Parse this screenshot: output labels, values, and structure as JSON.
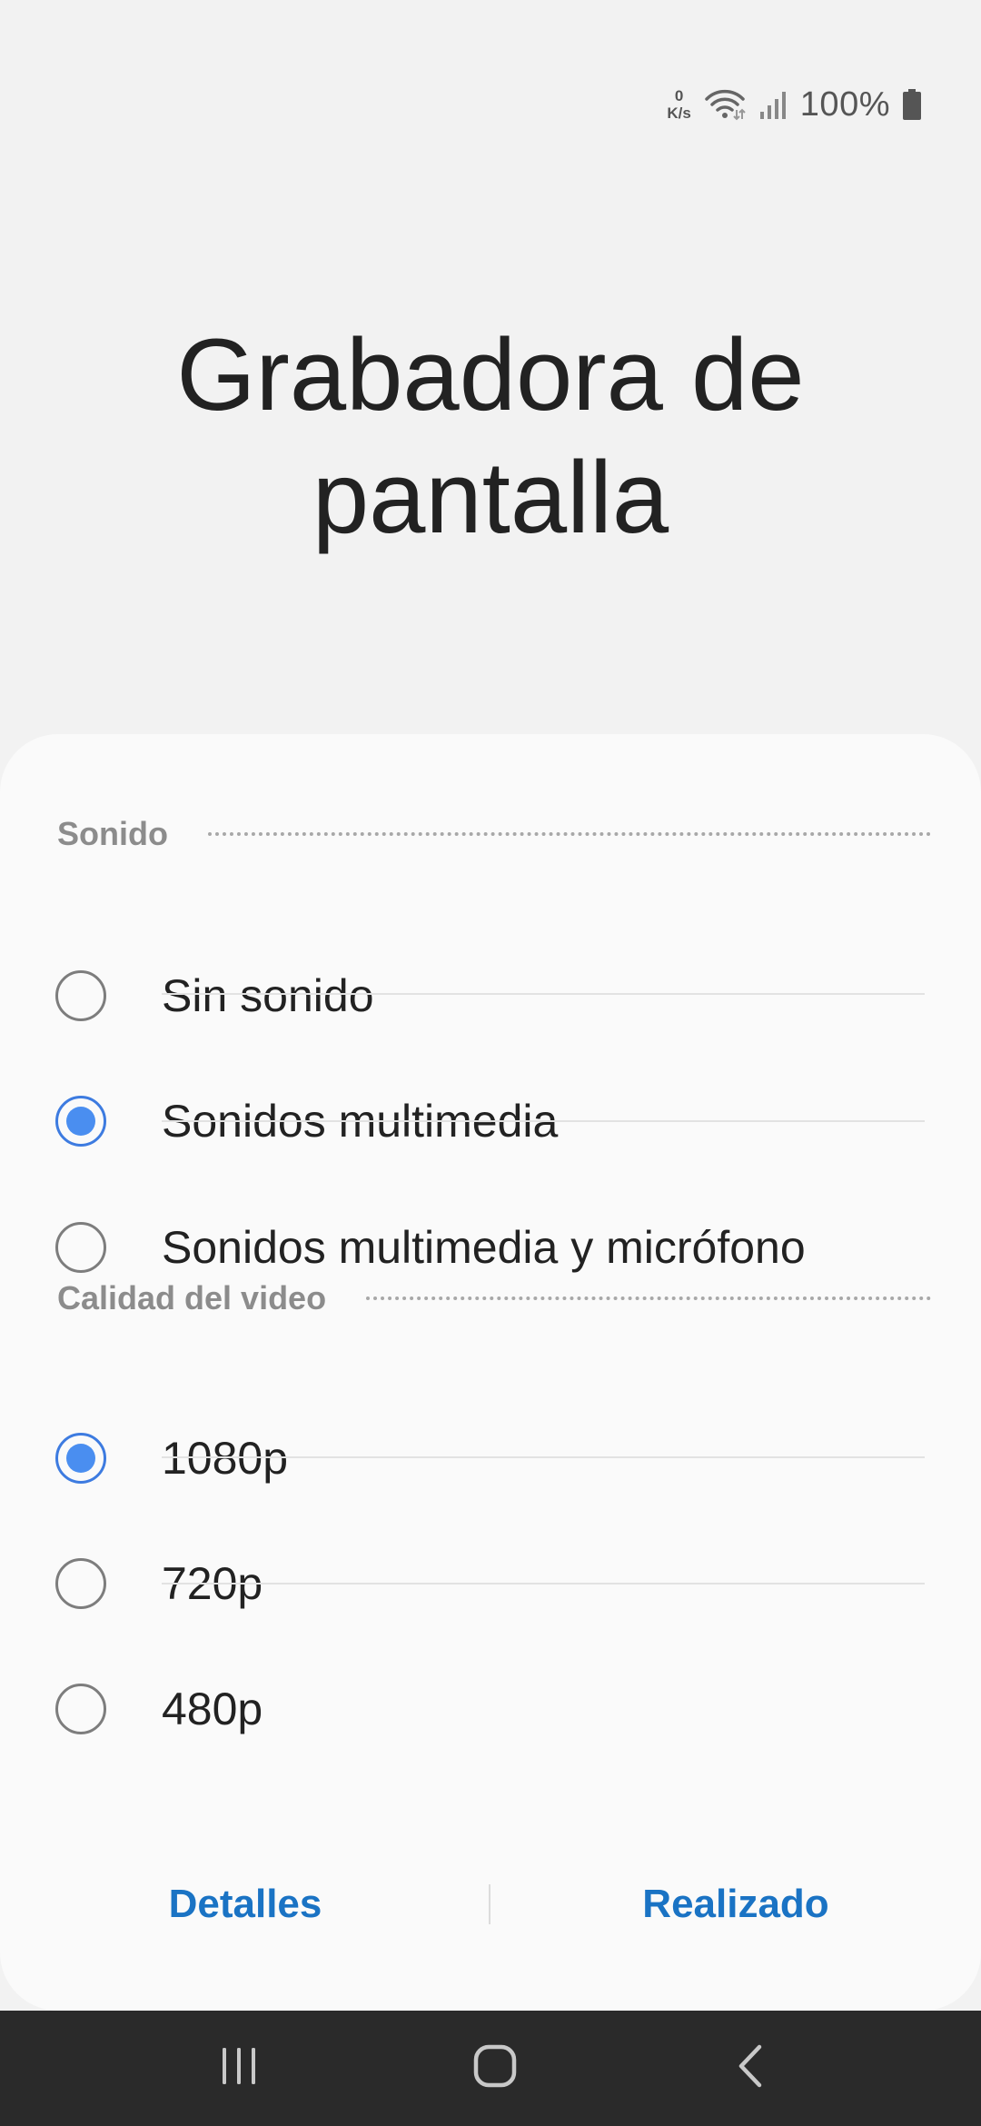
{
  "status_bar": {
    "net_speed_value": "0",
    "net_speed_unit": "K/s",
    "battery_percent": "100%"
  },
  "title": "Grabadora de pantalla",
  "sound_section": {
    "header": "Sonido",
    "options": [
      {
        "label": "Sin sonido",
        "selected": false
      },
      {
        "label": "Sonidos multimedia",
        "selected": true
      },
      {
        "label": "Sonidos multimedia y micrófono",
        "selected": false
      }
    ]
  },
  "video_section": {
    "header": "Calidad del video",
    "options": [
      {
        "label": "1080p",
        "selected": true
      },
      {
        "label": "720p",
        "selected": false
      },
      {
        "label": "480p",
        "selected": false
      }
    ]
  },
  "buttons": {
    "details": "Detalles",
    "done": "Realizado"
  },
  "colors": {
    "accent": "#1a73c4",
    "radio_selected": "#4a8ef0",
    "background": "#f2f2f2",
    "sheet": "#fafafa",
    "nav_bar": "#2a2a2a"
  },
  "nav_bar": {
    "icons": [
      "recents-icon",
      "home-icon",
      "back-icon"
    ]
  }
}
